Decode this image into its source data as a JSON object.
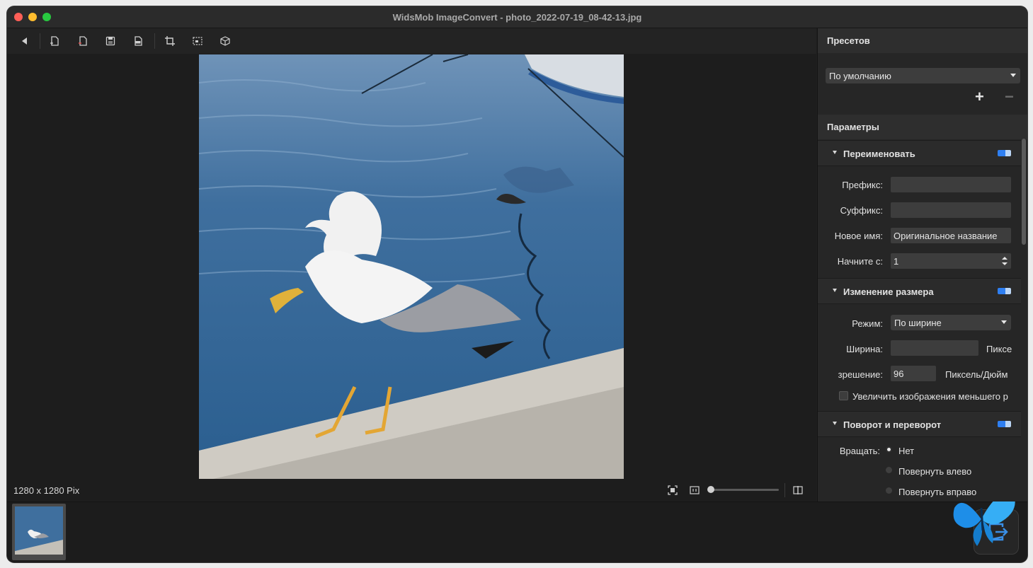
{
  "window": {
    "title": "WidsMob ImageConvert - photo_2022-07-19_08-42-13.jpg"
  },
  "toolbar": {
    "icons": [
      "back-icon",
      "add-file-icon",
      "remove-file-icon",
      "save-icon",
      "pdf-icon",
      "crop-icon",
      "watermark-icon",
      "3d-box-icon"
    ]
  },
  "viewer": {
    "image_size": "1280 x 1280 Pix",
    "zoom_level": 0.0
  },
  "presets": {
    "header": "Пресетов",
    "selected": "По умолчанию",
    "add_symbol": "+",
    "remove_symbol": "−"
  },
  "params": {
    "header": "Параметры",
    "rename": {
      "label": "Переименовать",
      "enabled": true,
      "prefix_label": "Префикс:",
      "prefix_value": "",
      "suffix_label": "Суффикс:",
      "suffix_value": "",
      "newname_label": "Новое имя:",
      "newname_value": "Оригинальное название",
      "start_label": "Начните с:",
      "start_value": "1"
    },
    "resize": {
      "label": "Изменение размера",
      "enabled": true,
      "mode_label": "Режим:",
      "mode_value": "По ширине",
      "width_label": "Ширина:",
      "width_value": "",
      "width_unit": "Пиксе",
      "res_label": "зрешение:",
      "res_value": "96",
      "res_unit": "Пиксель/Дюйм",
      "enlarge_label": "Увеличить изображения меньшего р",
      "enlarge_checked": false
    },
    "rotate": {
      "label": "Поворот и переворот",
      "enabled": true,
      "rotate_label": "Вращать:",
      "options": [
        "Нет",
        "Повернуть влево",
        "Повернуть вправо"
      ],
      "selected": "Нет"
    }
  },
  "colors": {
    "accent": "#2e7ff2",
    "background": "#1f1f1f",
    "panel": "#262626"
  }
}
